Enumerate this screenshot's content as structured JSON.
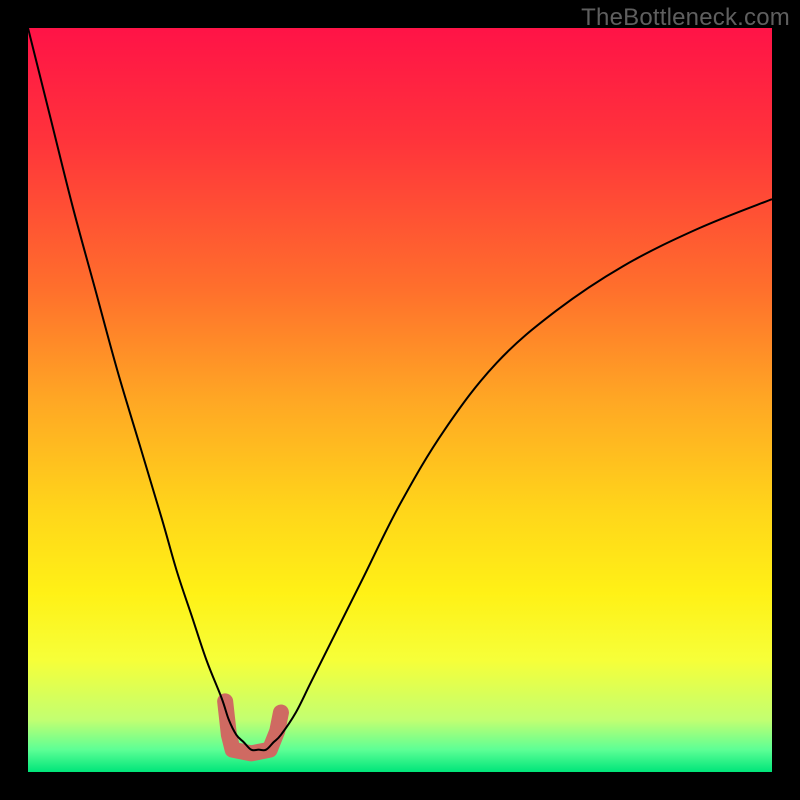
{
  "watermark": "TheBottleneck.com",
  "chart_data": {
    "type": "line",
    "title": "",
    "xlabel": "",
    "ylabel": "",
    "xlim": [
      0,
      100
    ],
    "ylim": [
      0,
      100
    ],
    "background_gradient": {
      "stops": [
        {
          "pos": 0.0,
          "color": "#ff1347"
        },
        {
          "pos": 0.15,
          "color": "#ff333b"
        },
        {
          "pos": 0.35,
          "color": "#ff6f2c"
        },
        {
          "pos": 0.5,
          "color": "#ffa724"
        },
        {
          "pos": 0.65,
          "color": "#ffd61a"
        },
        {
          "pos": 0.76,
          "color": "#fff116"
        },
        {
          "pos": 0.85,
          "color": "#f6ff39"
        },
        {
          "pos": 0.93,
          "color": "#c2ff71"
        },
        {
          "pos": 0.97,
          "color": "#5dff95"
        },
        {
          "pos": 1.0,
          "color": "#00e57a"
        }
      ]
    },
    "series": [
      {
        "name": "curve",
        "color": "#000000",
        "stroke_width": 2,
        "x": [
          0,
          3,
          6,
          9,
          12,
          15,
          18,
          20,
          22,
          24,
          26,
          27,
          28,
          29,
          30,
          31,
          32,
          33,
          34,
          36,
          38,
          41,
          45,
          50,
          56,
          63,
          71,
          80,
          90,
          100
        ],
        "y": [
          100,
          88,
          76,
          65,
          54,
          44,
          34,
          27,
          21,
          15,
          10,
          7,
          5,
          4,
          3,
          3,
          3,
          4,
          5,
          8,
          12,
          18,
          26,
          36,
          46,
          55,
          62,
          68,
          73,
          77
        ]
      },
      {
        "name": "marker-blob",
        "color": "#cf6a62",
        "type": "area",
        "points": [
          {
            "x": 26.5,
            "y": 9.5
          },
          {
            "x": 27.0,
            "y": 5.0
          },
          {
            "x": 27.5,
            "y": 3.0
          },
          {
            "x": 30.0,
            "y": 2.5
          },
          {
            "x": 32.5,
            "y": 3.0
          },
          {
            "x": 33.5,
            "y": 5.5
          },
          {
            "x": 34.0,
            "y": 8.0
          }
        ]
      }
    ]
  }
}
